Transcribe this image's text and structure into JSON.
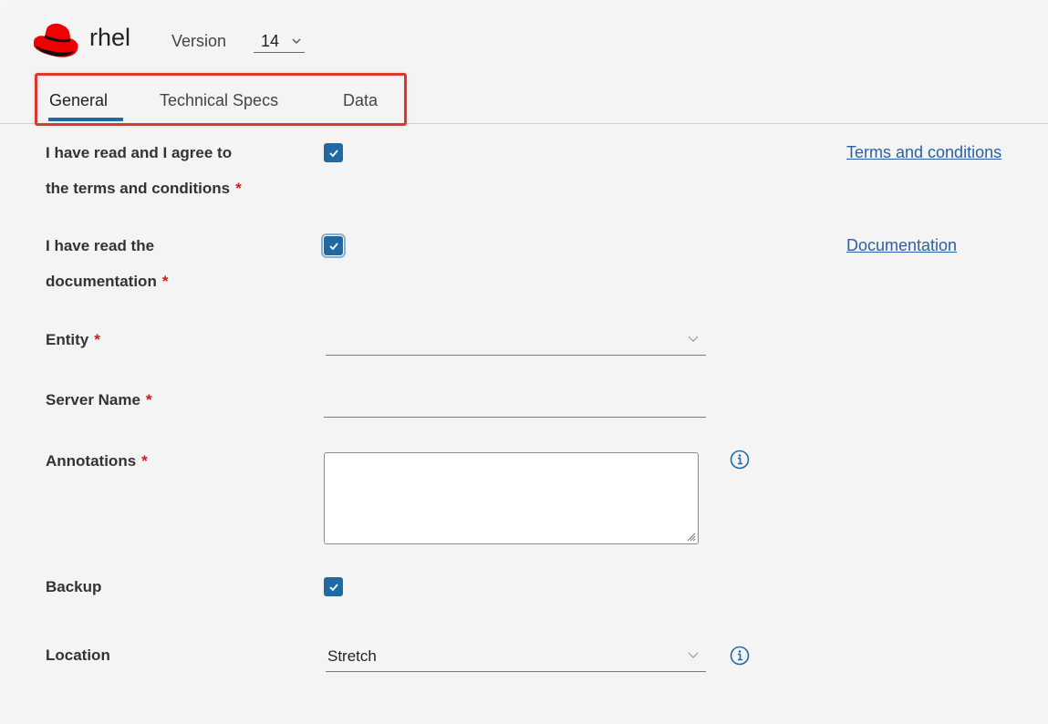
{
  "header": {
    "app_name": "rhel",
    "version_label": "Version",
    "version_value": "14"
  },
  "tabs": [
    {
      "label": "General",
      "active": true
    },
    {
      "label": "Technical Specs",
      "active": false
    },
    {
      "label": "Data",
      "active": false
    }
  ],
  "form": {
    "terms": {
      "label_line1": "I have read and I agree to",
      "label_line2": "the terms and conditions",
      "required_mark": "*",
      "checked": true,
      "link": "Terms and conditions"
    },
    "documentation": {
      "label_line1": "I have read the",
      "label_line2": "documentation",
      "required_mark": "*",
      "checked": true,
      "link": "Documentation"
    },
    "entity": {
      "label": "Entity",
      "required_mark": "*",
      "value": ""
    },
    "server_name": {
      "label": "Server Name",
      "required_mark": "*",
      "value": ""
    },
    "annotations": {
      "label": "Annotations",
      "required_mark": "*",
      "value": ""
    },
    "backup": {
      "label": "Backup",
      "checked": true
    },
    "location": {
      "label": "Location",
      "value": "Stretch"
    }
  },
  "colors": {
    "accent": "#1d6aa7",
    "required": "#d11a1a",
    "link": "#2d5fa8",
    "highlight": "#d93a2b"
  },
  "icons": {
    "logo": "redhat-logo",
    "dropdown": "chevron-down-icon",
    "info": "info-icon",
    "check": "check-icon"
  }
}
